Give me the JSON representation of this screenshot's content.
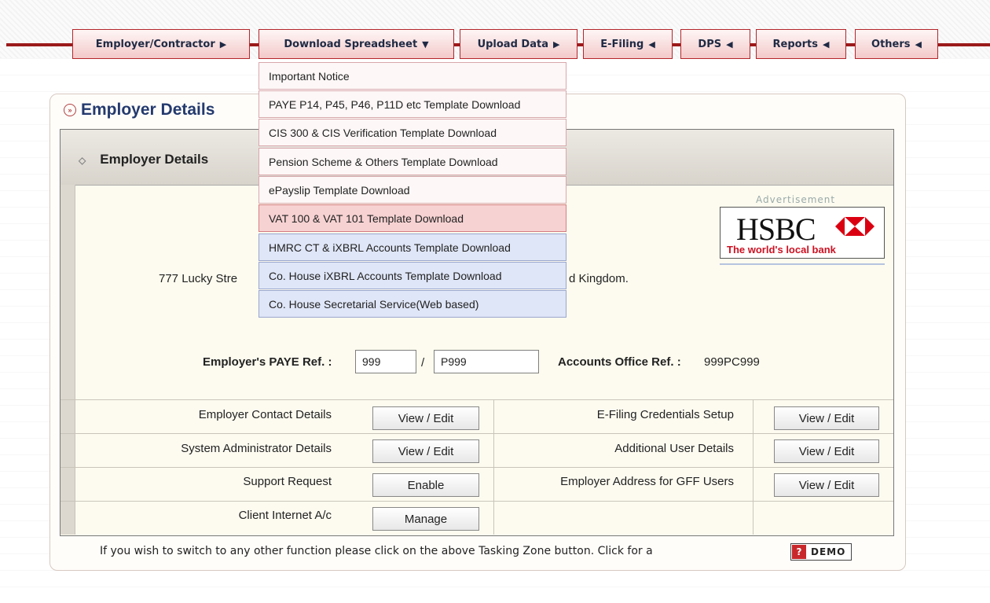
{
  "nav": {
    "tabs": [
      {
        "label": "Employer/Contractor",
        "arrow": "▶"
      },
      {
        "label": "Download Spreadsheet",
        "arrow": "▼"
      },
      {
        "label": "Upload Data",
        "arrow": "▶"
      },
      {
        "label": "E-Filing",
        "arrow": "◀"
      },
      {
        "label": "DPS",
        "arrow": "◀"
      },
      {
        "label": "Reports",
        "arrow": "◀"
      },
      {
        "label": "Others",
        "arrow": "◀"
      }
    ]
  },
  "dropdown": {
    "items": [
      "Important Notice",
      "PAYE P14, P45, P46, P11D etc Template Download",
      "CIS 300 & CIS Verification Template Download",
      "Pension Scheme & Others Template Download",
      "ePayslip Template Download",
      "VAT 100 & VAT 101 Template Download",
      "HMRC CT & iXBRL Accounts Template Download",
      "Co. House iXBRL Accounts Template Download",
      "Co. House Secretarial Service(Web based)"
    ]
  },
  "panel": {
    "title": "Employer Details",
    "card_title": "Employer Details",
    "advert_label": "Advertisement",
    "advert_brand": "HSBC",
    "advert_tagline": "The world's local bank",
    "address_left": "777 Lucky Stre",
    "address_right": "d Kingdom.",
    "paye_label": "Employer's PAYE Ref. :",
    "paye_part1": "999",
    "paye_sep": "/",
    "paye_part2": "P999",
    "accounts_label": "Accounts Office Ref. :",
    "accounts_value": "999PC999"
  },
  "rows": {
    "r1": {
      "left_label": "Employer Contact Details",
      "left_button": "View / Edit",
      "right_label": "E-Filing Credentials Setup",
      "right_button": "View / Edit"
    },
    "r2": {
      "left_label": "System Administrator Details",
      "left_button": "View / Edit",
      "right_label": "Additional User Details",
      "right_button": "View / Edit"
    },
    "r3": {
      "left_label": "Support Request",
      "left_button": "Enable",
      "right_label": "Employer Address for GFF Users",
      "right_button": "View / Edit"
    },
    "r4": {
      "left_label": "Client Internet A/c",
      "left_button": "Manage"
    }
  },
  "footer": {
    "text": "If you wish to switch to any other function please click on the above Tasking Zone button. Click for a",
    "demo_label": "DEMO",
    "demo_icon": "?"
  },
  "colors": {
    "brand_red": "#9b1a1a",
    "tab_fill": "#f3c9c9",
    "highlight": "#f7d2d2",
    "blue_item": "#dfe6f7",
    "title_blue": "#233a6e"
  }
}
